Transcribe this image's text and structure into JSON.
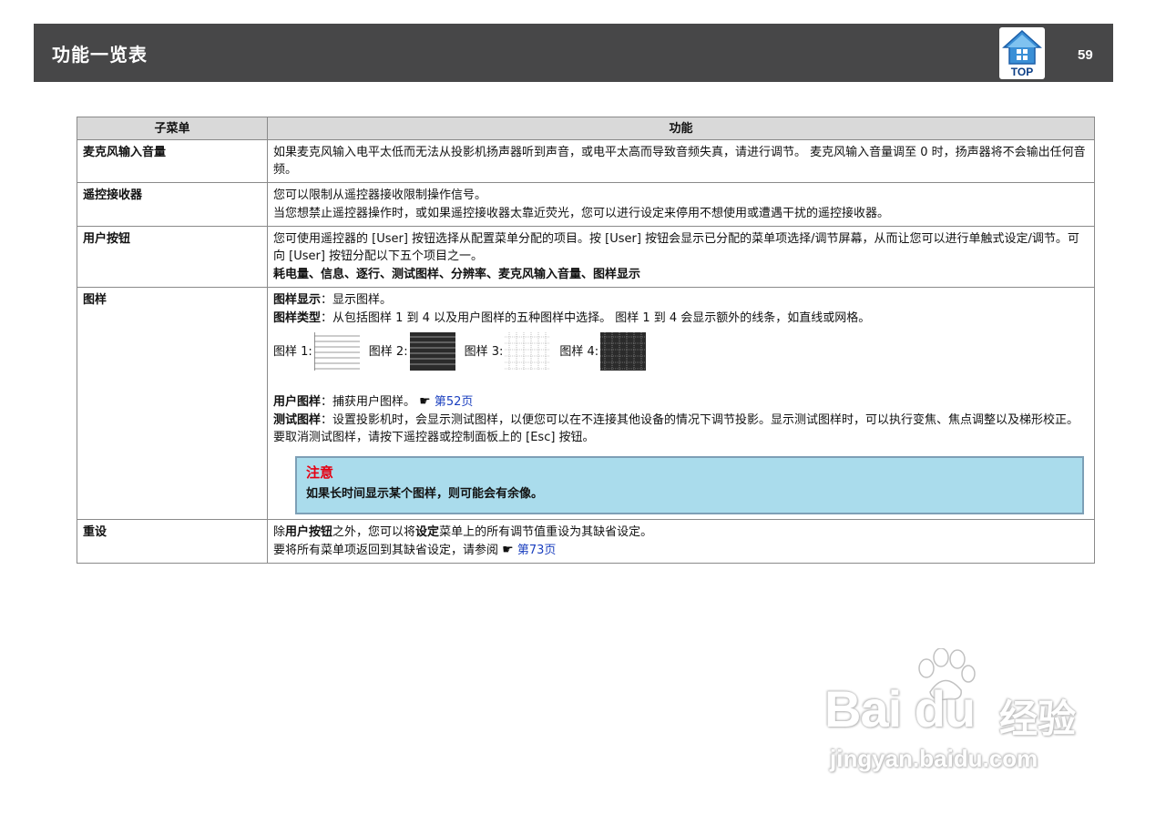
{
  "header": {
    "title": "功能一览表",
    "page_number": "59",
    "top_label": "TOP"
  },
  "table": {
    "columns": [
      "子菜单",
      "功能"
    ],
    "rows": [
      {
        "name": "麦克风输入音量",
        "lines": [
          "如果麦克风输入电平太低而无法从投影机扬声器听到声音，或电平太高而导致音频失真，请进行调节。 麦克风输入音量调至 0 时，扬声器将不会输出任何音频。"
        ]
      },
      {
        "name": "遥控接收器",
        "lines": [
          "您可以限制从遥控器接收限制操作信号。",
          "当您想禁止遥控器操作时，或如果遥控接收器太靠近荧光，您可以进行设定来停用不想使用或遭遇干扰的遥控接收器。"
        ]
      },
      {
        "name": "用户按钮",
        "lines": [
          "您可使用遥控器的 [User] 按钮选择从配置菜单分配的项目。按 [User] 按钮会显示已分配的菜单项选择/调节屏幕，从而让您可以进行单触式设定/调节。可向 [User] 按钮分配以下五个项目之一。",
          "耗电量、信息、逐行、测试图样、分辨率、麦克风输入音量、图样显示"
        ]
      },
      {
        "name": "图样",
        "display_label": "图样显示",
        "display_text": "：显示图样。",
        "type_label": "图样类型",
        "type_text": "：从包括图样 1 到 4 以及用户图样的五种图样中选择。 图样 1 到 4 会显示额外的线条，如直线或网格。",
        "patterns": [
          "图样 1:",
          "图样 2:",
          "图样 3:",
          "图样 4:"
        ],
        "user_label": "用户图样",
        "user_text": "：捕获用户图样。",
        "user_link": "第52页",
        "test_label": "测试图样",
        "test_text": "：设置投影机时，会显示测试图样，以便您可以在不连接其他设备的情况下调节投影。显示测试图样时，可以执行变焦、焦点调整以及梯形校正。要取消测试图样，请按下遥控器或控制面板上的 [Esc] 按钮。",
        "note_title": "注意",
        "note_text": "如果长时间显示某个图样，则可能会有余像。"
      },
      {
        "name": "重设",
        "line1_pre": "除",
        "line1_bold1": "用户按钮",
        "line1_mid": "之外，您可以将",
        "line1_bold2": "设定",
        "line1_post": "菜单上的所有调节值重设为其缺省设定。",
        "line2": "要将所有菜单项返回到其缺省设定，请参阅",
        "line2_link": "第73页"
      }
    ]
  },
  "colors": {
    "header_bg": "#474748",
    "table_header_bg": "#d9d9d9",
    "note_bg": "#aadcec",
    "note_title": "#e60012",
    "link": "#1a3fbf"
  },
  "watermark": {
    "brand": "Bai du",
    "cn": "经验",
    "url": "jingyan.baidu.com"
  },
  "icons": [
    "home-top-icon",
    "pointing-hand-icon",
    "paw-icon"
  ]
}
